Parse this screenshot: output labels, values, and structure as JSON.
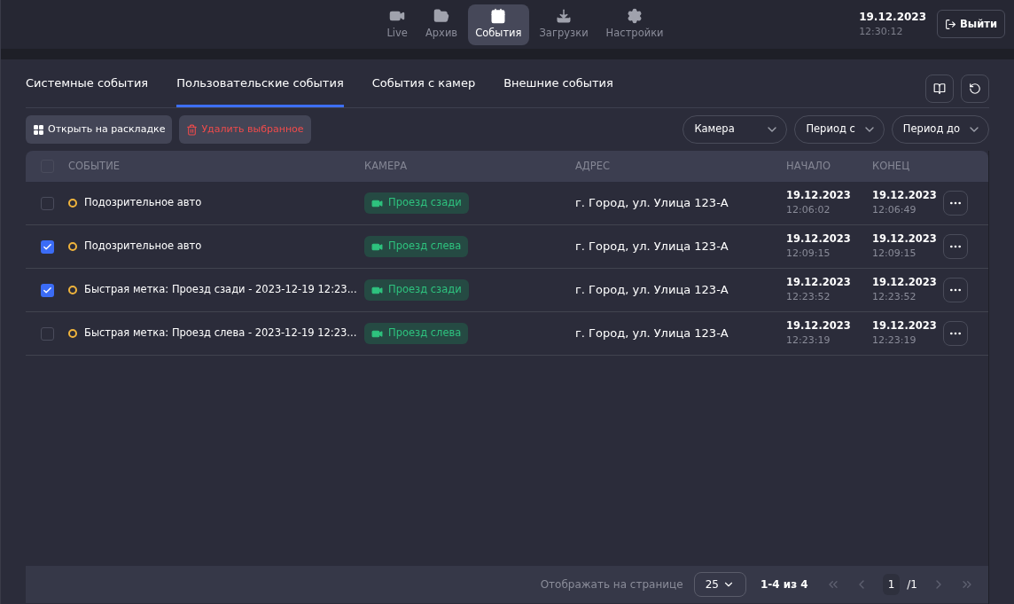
{
  "nav": [
    {
      "kind": "video",
      "label": "Live",
      "selected": false
    },
    {
      "kind": "folder",
      "label": "Архив",
      "selected": false
    },
    {
      "kind": "calendar",
      "label": "События",
      "selected": true
    },
    {
      "kind": "download",
      "label": "Загрузки",
      "selected": false
    },
    {
      "kind": "gear",
      "label": "Настройки",
      "selected": false
    }
  ],
  "clock": {
    "date": "19.12.2023",
    "time": "12:30:12"
  },
  "logout_button": "Выйти",
  "tabs": [
    {
      "label": "Системные события",
      "selected": false
    },
    {
      "label": "Пользовательские события",
      "selected": true
    },
    {
      "label": "События с камер",
      "selected": false
    },
    {
      "label": "Внешние события",
      "selected": false
    }
  ],
  "toolbar": {
    "open_button": "Открыть на раскладке",
    "delete_button": "Удалить выбранное",
    "filters": [
      "Камера",
      "Период с",
      "Период до"
    ]
  },
  "table": {
    "header_checked": false,
    "columns": [
      "СОБЫТИЕ",
      "КАМЕРА",
      "АДРЕС",
      "НАЧАЛО",
      "КОНЕЦ"
    ],
    "rows": [
      {
        "checked": false,
        "event": "Подозрительное авто",
        "camera": "Проезд сзади",
        "address": "г. Город, ул. Улица 123-А",
        "start_date": "19.12.2023",
        "start_time": "12:06:02",
        "end_date": "19.12.2023",
        "end_time": "12:06:49"
      },
      {
        "checked": true,
        "event": "Подозрительное авто",
        "camera": "Проезд слева",
        "address": "г. Город, ул. Улица 123-А",
        "start_date": "19.12.2023",
        "start_time": "12:09:15",
        "end_date": "19.12.2023",
        "end_time": "12:09:15"
      },
      {
        "checked": true,
        "event": "Быстрая метка: Проезд сзади - 2023-12-19 12:23...",
        "camera": "Проезд сзади",
        "address": "г. Город, ул. Улица 123-А",
        "start_date": "19.12.2023",
        "start_time": "12:23:52",
        "end_date": "19.12.2023",
        "end_time": "12:23:52"
      },
      {
        "checked": false,
        "event": "Быстрая метка: Проезд слева - 2023-12-19 12:23...",
        "camera": "Проезд слева",
        "address": "г. Город, ул. Улица 123-А",
        "start_date": "19.12.2023",
        "start_time": "12:23:19",
        "end_date": "19.12.2023",
        "end_time": "12:23:19"
      }
    ]
  },
  "pagination": {
    "per_page_label": "Отображать на странице",
    "per_page": "25",
    "range": "1-4 из 4",
    "page": "1",
    "total": "/1"
  }
}
